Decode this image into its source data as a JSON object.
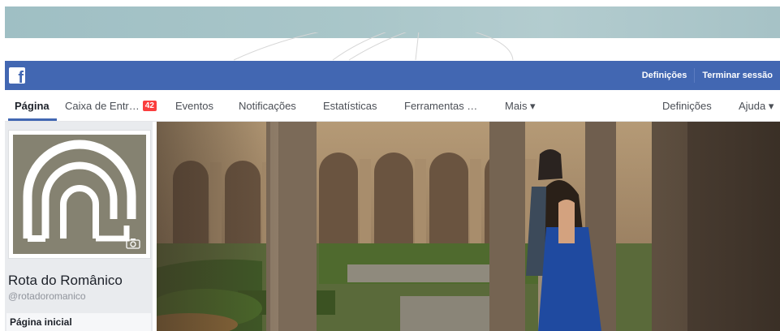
{
  "facebook_bar": {
    "logo_icon": "facebook-f-icon",
    "logo_letter": "f",
    "links": [
      "Definições",
      "Terminar sessão"
    ],
    "color": "#4267b2"
  },
  "page_nav": {
    "tabs": [
      {
        "label": "Página",
        "active": true
      },
      {
        "label": "Caixa de Entr…",
        "badge": "42"
      },
      {
        "label": "Eventos"
      },
      {
        "label": "Notificações"
      },
      {
        "label": "Estatísticas"
      },
      {
        "label": "Ferramentas …"
      },
      {
        "label": "Mais ▾"
      }
    ],
    "right": [
      "Definições",
      "Ajuda ▾"
    ]
  },
  "sidebar": {
    "profile_picture_icon": "rota-do-romanico-arch-logo",
    "camera_icon": "camera-icon",
    "page_name": "Rota do Românico",
    "handle": "@rotadoromanico",
    "menu_items": [
      "Página inicial"
    ]
  },
  "cover": {
    "description_icon": "romanesque-cloister-photo"
  }
}
